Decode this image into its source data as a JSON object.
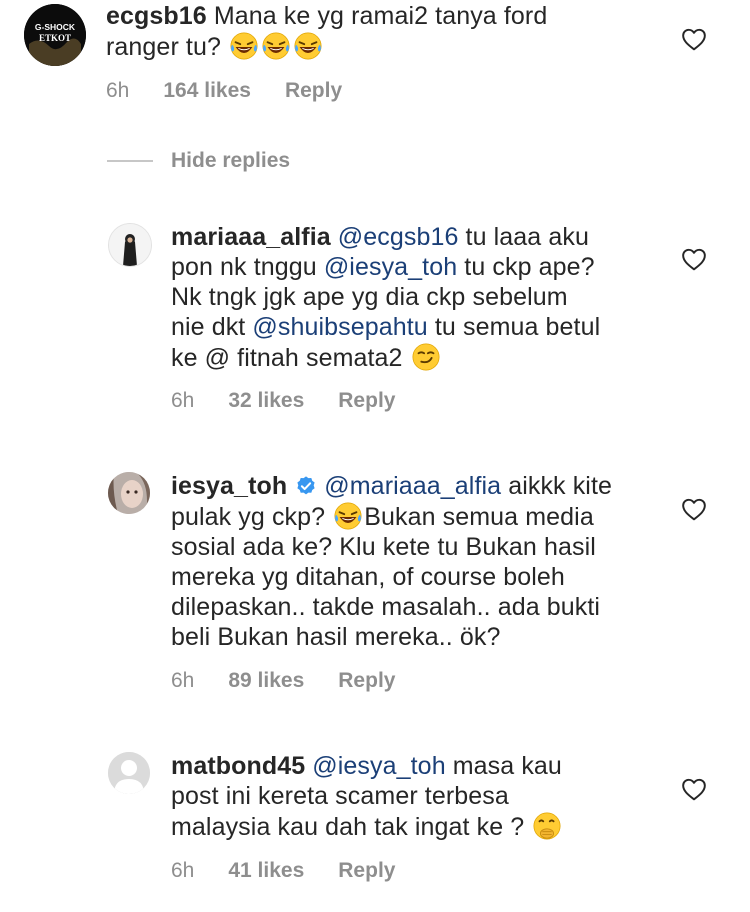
{
  "comments": [
    {
      "username": "ecgsb16",
      "avatar_label": "G-SHOCK ETKOT",
      "text_a": "Mana ke yg ramai2 tanya ford",
      "text_b": "ranger tu?",
      "time": "6h",
      "likes": "164 likes",
      "reply": "Reply"
    },
    {
      "username": "mariaaa_alfia",
      "m1": "@ecgsb16",
      "t1": "tu laaa aku",
      "t2a": "pon nk tnggu",
      "m2": "@iesya_toh",
      "t2b": "tu ckp ape?",
      "t3": "Nk tngk jgk ape yg dia ckp sebelum",
      "t4a": "nie dkt",
      "m3": "@shuibsepahtu",
      "t4b": "tu semua betul",
      "t5": "ke @ fitnah semata2",
      "time": "6h",
      "likes": "32 likes",
      "reply": "Reply"
    },
    {
      "username": "iesya_toh",
      "m1": "@mariaaa_alfia",
      "t1": "aikkk kite",
      "t2a": "pulak yg ckp?",
      "t2b": "Bukan semua media",
      "t3": "sosial ada ke? Klu kete tu Bukan hasil",
      "t4": "mereka yg ditahan, of course boleh",
      "t5": "dilepaskan.. takde masalah.. ada bukti",
      "t6": "beli Bukan hasil mereka.. ök?",
      "time": "6h",
      "likes": "89 likes",
      "reply": "Reply"
    },
    {
      "username": "matbond45",
      "m1": "@iesya_toh",
      "t1": "masa kau",
      "t2": "post ini kereta scamer terbesa",
      "t3": "malaysia kau dah tak ingat ke ?",
      "time": "6h",
      "likes": "41 likes",
      "reply": "Reply"
    }
  ],
  "hide_replies": "Hide replies",
  "colors": {
    "text": "#262626",
    "meta": "#8e8e8e",
    "mention": "#1b3f77",
    "verified": "#3897f0"
  }
}
